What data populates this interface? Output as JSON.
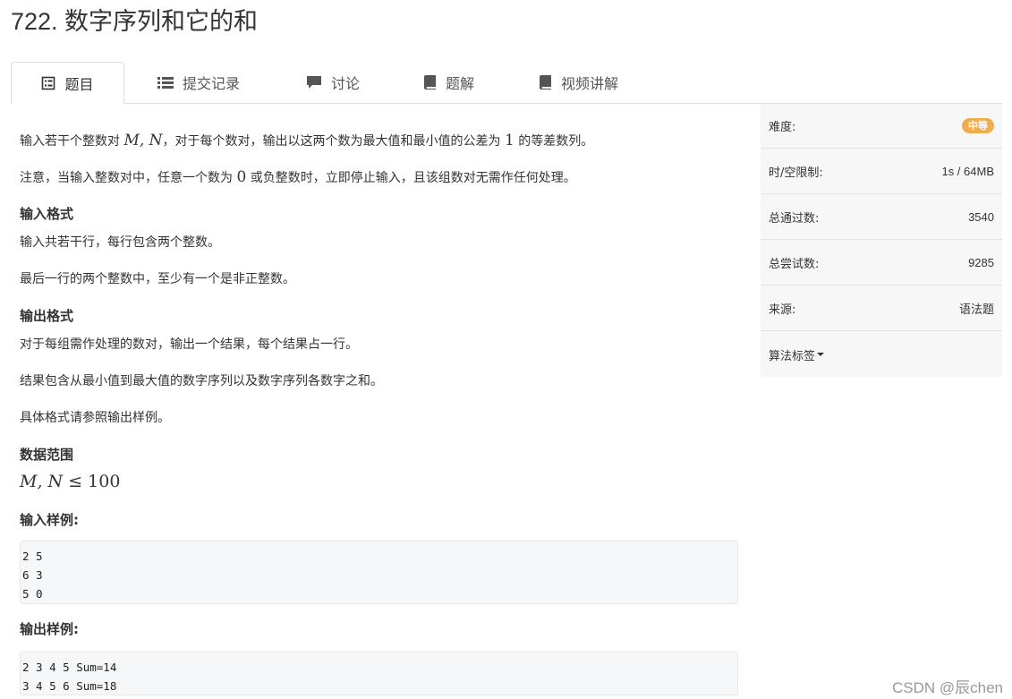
{
  "problem": {
    "title": "722. 数字序列和它的和"
  },
  "tabs": [
    {
      "label": "题目",
      "icon": "document-list-icon",
      "active": true
    },
    {
      "label": "提交记录",
      "icon": "list-icon",
      "active": false
    },
    {
      "label": "讨论",
      "icon": "comment-icon",
      "active": false
    },
    {
      "label": "题解",
      "icon": "book-icon",
      "active": false
    },
    {
      "label": "视频讲解",
      "icon": "book-icon",
      "active": false
    }
  ],
  "statement": {
    "intro_before": "输入若干个整数对 ",
    "intro_vars": "M, N",
    "intro_mid": "，对于每个数对，输出以这两个数为最大值和最小值的公差为 ",
    "intro_num": "1",
    "intro_after": " 的等差数列。",
    "note_before": "注意，当输入整数对中，任意一个数为 ",
    "note_num": "0",
    "note_after": " 或负整数时，立即停止输入，且该组数对无需作任何处理。",
    "input_heading": "输入格式",
    "input_p1": "输入共若干行，每行包含两个整数。",
    "input_p2": "最后一行的两个整数中，至少有一个是非正整数。",
    "output_heading": "输出格式",
    "output_p1": "对于每组需作处理的数对，输出一个结果，每个结果占一行。",
    "output_p2": "结果包含从最小值到最大值的数字序列以及数字序列各数字之和。",
    "output_p3": "具体格式请参照输出样例。",
    "range_heading": "数据范围",
    "range_vars": "M, N",
    "range_op": " ≤ ",
    "range_num": "100",
    "sample_in_heading": "输入样例:",
    "sample_in": "2 5\n6 3\n5 0",
    "sample_out_heading": "输出样例:",
    "sample_out": "2 3 4 5 Sum=14\n3 4 5 6 Sum=18"
  },
  "sidebar": {
    "difficulty_label": "难度:",
    "difficulty_value": "中等",
    "limit_label": "时/空限制:",
    "limit_value": "1s / 64MB",
    "passed_label": "总通过数:",
    "passed_value": "3540",
    "tried_label": "总尝试数:",
    "tried_value": "9285",
    "source_label": "来源:",
    "source_value": "语法题",
    "tags_label": "算法标签"
  },
  "watermark": "CSDN @辰chen",
  "colors": {
    "badge": "#f0ad4e",
    "sidebar_bg": "#f7f7f7",
    "code_bg": "#f6f7f8"
  }
}
